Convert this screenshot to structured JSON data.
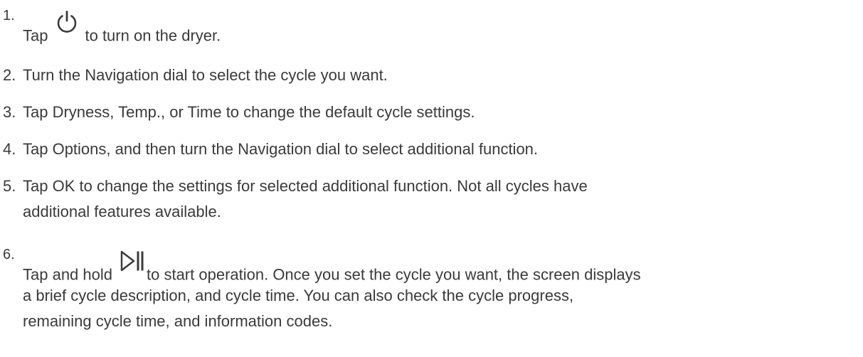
{
  "steps": [
    {
      "number": "1.",
      "before": "Tap",
      "icon": "power-icon",
      "after": "to turn on the dryer."
    },
    {
      "number": "2.",
      "text": "Turn the Navigation dial to select the cycle you want."
    },
    {
      "number": "3.",
      "text": "Tap Dryness, Temp., or Time to change the default cycle settings."
    },
    {
      "number": "4.",
      "text": "Tap Options, and then turn the Navigation dial to select additional function."
    },
    {
      "number": "5.",
      "line1": "Tap OK to change the settings for selected additional function. Not all cycles have",
      "line2": "additional features available."
    },
    {
      "number": "6.",
      "before": "Tap and hold",
      "icon": "play-pause-icon",
      "line1_after": "to start operation. Once you set the cycle you want, the screen displays",
      "line2": "a brief cycle description, and cycle time. You can also check the cycle progress,",
      "line3": "remaining cycle time, and information codes."
    }
  ]
}
